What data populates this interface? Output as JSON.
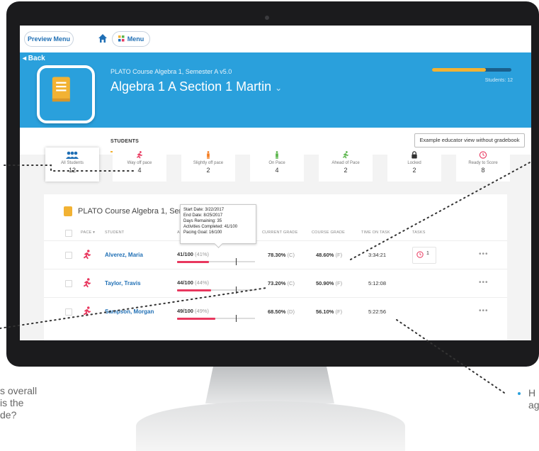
{
  "topbar": {
    "preview_menu": "Preview Menu",
    "menu_label": "Menu"
  },
  "hero": {
    "back_label": "◂ Back",
    "course_subtitle": "PLATO Course Algebra 1, Semester A v5.0",
    "course_title": "Algebra 1 A Section 1 Martin",
    "chevron": "⌄",
    "progress_fraction": 0.68,
    "students_label": "Students: 12"
  },
  "tabs": {
    "students": "STUDENTS",
    "gradebook_button": "Example educator view without gradebook"
  },
  "filters": [
    {
      "label": "All Students",
      "count": "12",
      "icon": "group-icon",
      "color": "#1f6fb5"
    },
    {
      "label": "Way off pace",
      "count": "4",
      "icon": "runner-icon",
      "color": "#e8375e"
    },
    {
      "label": "Slightly off pace",
      "count": "2",
      "icon": "person-icon",
      "color": "#f47c20"
    },
    {
      "label": "On Pace",
      "count": "4",
      "icon": "person-icon",
      "color": "#5ab54b"
    },
    {
      "label": "Ahead of Pace",
      "count": "2",
      "icon": "runner-icon",
      "color": "#5ab54b"
    },
    {
      "label": "Locked",
      "count": "2",
      "icon": "lock-icon",
      "color": "#333333"
    },
    {
      "label": "Ready to Score",
      "count": "8",
      "icon": "clock-icon",
      "color": "#e8375e"
    }
  ],
  "panel": {
    "title": "PLATO Course Algebra 1, Ser",
    "headers": {
      "pace": "PACE ▾",
      "student": "STUDENT",
      "activities": "A",
      "current_grade": "CURRENT GRADE",
      "course_grade": "COURSE GRADE",
      "time_on_task": "TIME ON TASK",
      "tasks": "TASKS"
    }
  },
  "tooltip": {
    "start_date": "Start Date: 3/22/2017",
    "end_date": "End Date: 8/25/2017",
    "days_remaining": "Days Remaining: 35",
    "activities_completed": "Activities Completed: 41/100",
    "pacing_goal": "Pacing Goal: 16/100"
  },
  "rows": [
    {
      "name": "Alverez, Maria",
      "activities": "41/100",
      "activities_pct": "(41%)",
      "progress": 0.41,
      "pace_goal": 0.75,
      "current_grade": "78.30%",
      "current_letter": "(C)",
      "course_grade": "48.60%",
      "course_letter": "(F)",
      "time_on_task": "3:34:21",
      "tasks": "1",
      "more": "•••"
    },
    {
      "name": "Taylor, Travis",
      "activities": "44/100",
      "activities_pct": "(44%)",
      "progress": 0.44,
      "pace_goal": 0.75,
      "current_grade": "73.20%",
      "current_letter": "(C)",
      "course_grade": "50.90%",
      "course_letter": "(F)",
      "time_on_task": "5:12:08",
      "more": "•••"
    },
    {
      "name": "Sampson, Morgan",
      "activities": "49/100",
      "activities_pct": "(49%)",
      "progress": 0.49,
      "pace_goal": 0.75,
      "current_grade": "68.50%",
      "current_letter": "(D)",
      "course_grade": "56.10%",
      "course_letter": "(F)",
      "time_on_task": "5:22:56",
      "more": "•••"
    }
  ],
  "callouts": {
    "left_line1": "s overall",
    "left_line2": "is the",
    "left_line3": "de?",
    "right_line1": "H",
    "right_line2": "ag"
  },
  "colors": {
    "hero_blue": "#2aa0dc",
    "accent_yellow": "#f2b233",
    "pink": "#e8375e",
    "link_blue": "#1f6fb5"
  }
}
